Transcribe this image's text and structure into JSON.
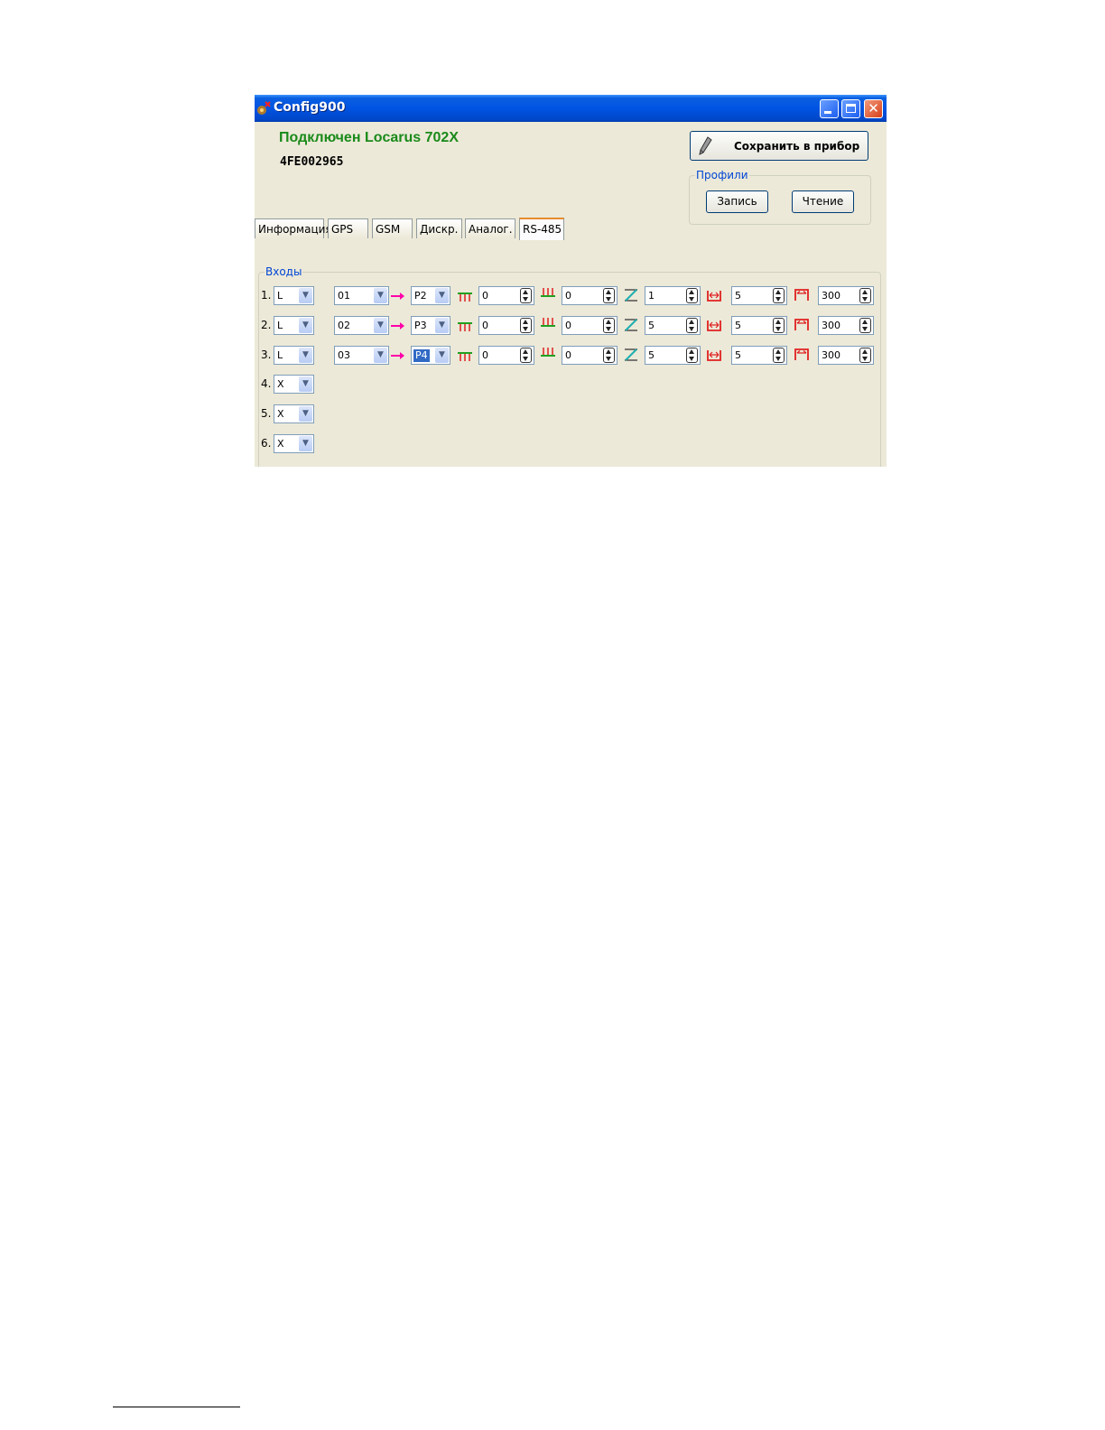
{
  "window": {
    "title": "Config900"
  },
  "header": {
    "connected": "Подключен Locarus 702X",
    "serial": "4FE002965"
  },
  "toolbar": {
    "save_label": "Сохранить в прибор"
  },
  "profiles": {
    "legend": "Профили",
    "write_label": "Запись",
    "read_label": "Чтение"
  },
  "tabs": [
    {
      "label": "Информация"
    },
    {
      "label": "GPS"
    },
    {
      "label": "GSM"
    },
    {
      "label": "Дискр."
    },
    {
      "label": "Аналог."
    },
    {
      "label": "RS-485"
    }
  ],
  "active_tab": "RS-485",
  "inputs": {
    "legend": "Входы",
    "rows": [
      {
        "num": "1.",
        "type": "L",
        "addr": "01",
        "param": "P2",
        "v1": "0",
        "v2": "0",
        "v3": "1",
        "v4": "5",
        "v5": "300"
      },
      {
        "num": "2.",
        "type": "L",
        "addr": "02",
        "param": "P3",
        "v1": "0",
        "v2": "0",
        "v3": "5",
        "v4": "5",
        "v5": "300"
      },
      {
        "num": "3.",
        "type": "L",
        "addr": "03",
        "param": "P4",
        "v1": "0",
        "v2": "0",
        "v3": "5",
        "v4": "5",
        "v5": "300"
      },
      {
        "num": "4.",
        "type": "X"
      },
      {
        "num": "5.",
        "type": "X"
      },
      {
        "num": "6.",
        "type": "X"
      }
    ]
  },
  "icons": {
    "app": "config-app-icon",
    "arrow": "arrow-right-icon",
    "lower": "lower-threshold-icon",
    "upper": "upper-threshold-icon",
    "filter": "filter-icon",
    "width": "width-icon",
    "period": "period-icon"
  },
  "colors": {
    "connected_text": "#1a8a1a",
    "legend_text": "#0046d5",
    "titlebar": "#0054e3",
    "arrow": "#ff00aa",
    "icon_red": "#e02020",
    "icon_green": "#20a020"
  }
}
